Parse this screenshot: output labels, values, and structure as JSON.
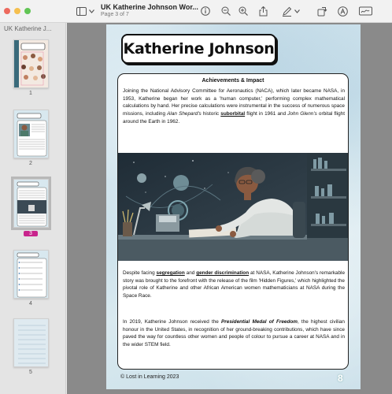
{
  "window": {
    "title": "UK Katherine Johnson Wor...",
    "subtitle": "Page 3 of 7"
  },
  "sidebar": {
    "label": "UK Katherine J...",
    "thumbnails": [
      {
        "number": "1",
        "selected": false
      },
      {
        "number": "2",
        "selected": false
      },
      {
        "number": "3",
        "selected": true
      },
      {
        "number": "4",
        "selected": false
      },
      {
        "number": "5",
        "selected": false
      }
    ]
  },
  "page": {
    "title": "Katherine Johnson",
    "section_heading": "Achievements & Impact",
    "paragraph1": {
      "a": "Joining the National Advisory Committee for Aeronautics (NACA), which later became NASA, in 1953, Katherine began her work as a 'human computer,' performing complex mathematical calculations by hand. Her precise calculations were instrumental in the success of numerous space missions, including ",
      "b": "Alan Shepard's",
      "c": " historic ",
      "d": "suborbital",
      "e": " flight in 1961 and ",
      "f": "John Glenn's",
      "g": " orbital flight around the Earth in 1962."
    },
    "paragraph2": {
      "a": "Despite facing ",
      "b": "segregation",
      "c": " and ",
      "d": "gender discrimination",
      "e": " at NASA, Katherine Johnson's remarkable story was brought to the forefront with the release of the film 'Hidden Figures,' which highlighted the pivotal role of Katherine and other African American women mathematicians at NASA during the Space Race."
    },
    "paragraph3": {
      "a": "In 2019, Katherine Johnson received the ",
      "b": "Presidential Medal of Freedom",
      "c": ", the highest civilian honour in the United States, in recognition of her ground-breaking contributions, which have since paved the way for countless other women and people of colour to pursue a career at NASA and in the wider STEM field."
    },
    "credit": "© Lost in Learning 2023",
    "page_number": "8"
  },
  "icons": [
    "sidebar-toggle-icon",
    "chevron-down-icon",
    "info-icon",
    "zoom-out-icon",
    "zoom-in-icon",
    "share-icon",
    "markup-pen-icon",
    "rotate-icon",
    "crop-icon",
    "highlight-icon",
    "signature-icon"
  ]
}
